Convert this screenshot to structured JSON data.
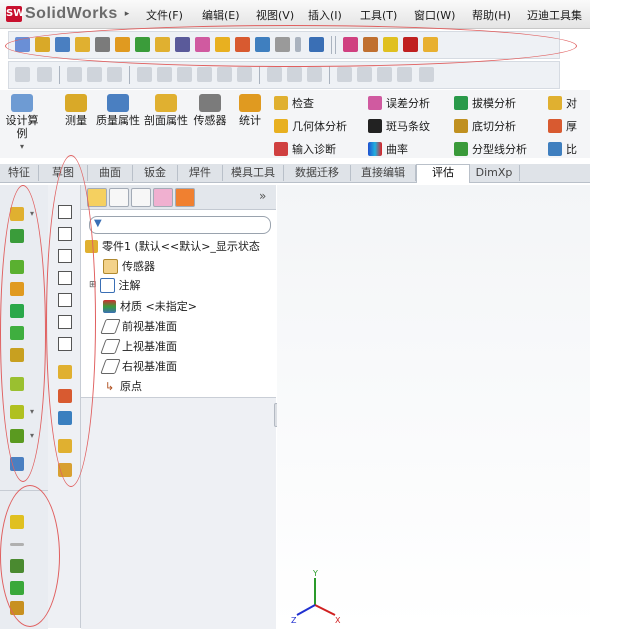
{
  "app": {
    "name": "SolidWorks",
    "logo_mark": "SW"
  },
  "menu": [
    "文件(F)",
    "编辑(E)",
    "视图(V)",
    "插入(I)",
    "工具(T)",
    "窗口(W)",
    "帮助(H)",
    "迈迪工具集"
  ],
  "command_manager": {
    "big_buttons": [
      {
        "label": "设计算例",
        "icon": "design-study-icon"
      },
      {
        "label": "测量",
        "icon": "measure-icon"
      },
      {
        "label": "质量属性",
        "icon": "mass-properties-icon"
      },
      {
        "label": "剖面属性",
        "icon": "section-properties-icon"
      },
      {
        "label": "传感器",
        "icon": "sensor-icon"
      },
      {
        "label": "统计",
        "icon": "statistics-icon"
      }
    ],
    "small_buttons": [
      {
        "label": "检查",
        "icon": "check-icon"
      },
      {
        "label": "几何体分析",
        "icon": "geometry-analysis-icon"
      },
      {
        "label": "输入诊断",
        "icon": "import-diagnostics-icon"
      },
      {
        "label": "误差分析",
        "icon": "deviation-analysis-icon"
      },
      {
        "label": "斑马条纹",
        "icon": "zebra-stripes-icon"
      },
      {
        "label": "曲率",
        "icon": "curvature-icon"
      },
      {
        "label": "拔模分析",
        "icon": "draft-analysis-icon"
      },
      {
        "label": "底切分析",
        "icon": "undercut-analysis-icon"
      },
      {
        "label": "分型线分析",
        "icon": "parting-line-analysis-icon"
      },
      {
        "label": "对",
        "icon": "symmetry-icon"
      },
      {
        "label": "厚",
        "icon": "thickness-icon"
      },
      {
        "label": "比",
        "icon": "compare-icon"
      }
    ]
  },
  "tabs": [
    "特征",
    "草图",
    "曲面",
    "钣金",
    "焊件",
    "模具工具",
    "数据迁移",
    "直接编辑",
    "评估",
    "DimXp"
  ],
  "active_tab": "评估",
  "tree": {
    "root": "零件1 (默认<<默认>_显示状态",
    "items": [
      {
        "label": "传感器",
        "icon": "sensor-folder-icon"
      },
      {
        "label": "注解",
        "icon": "annotations-icon"
      },
      {
        "label": "材质 <未指定>",
        "icon": "material-icon"
      },
      {
        "label": "前视基准面",
        "icon": "plane-icon"
      },
      {
        "label": "上视基准面",
        "icon": "plane-icon"
      },
      {
        "label": "右视基准面",
        "icon": "plane-icon"
      },
      {
        "label": "原点",
        "icon": "origin-icon"
      }
    ]
  },
  "panel": {
    "expand_label": "»",
    "collapse_label": "⁞"
  },
  "triad": {
    "x": "X",
    "y": "Y",
    "z": "Z"
  },
  "colors": {
    "accent": "#c8102e",
    "annotation": "#e06060",
    "tab_active": "#ffffff"
  }
}
